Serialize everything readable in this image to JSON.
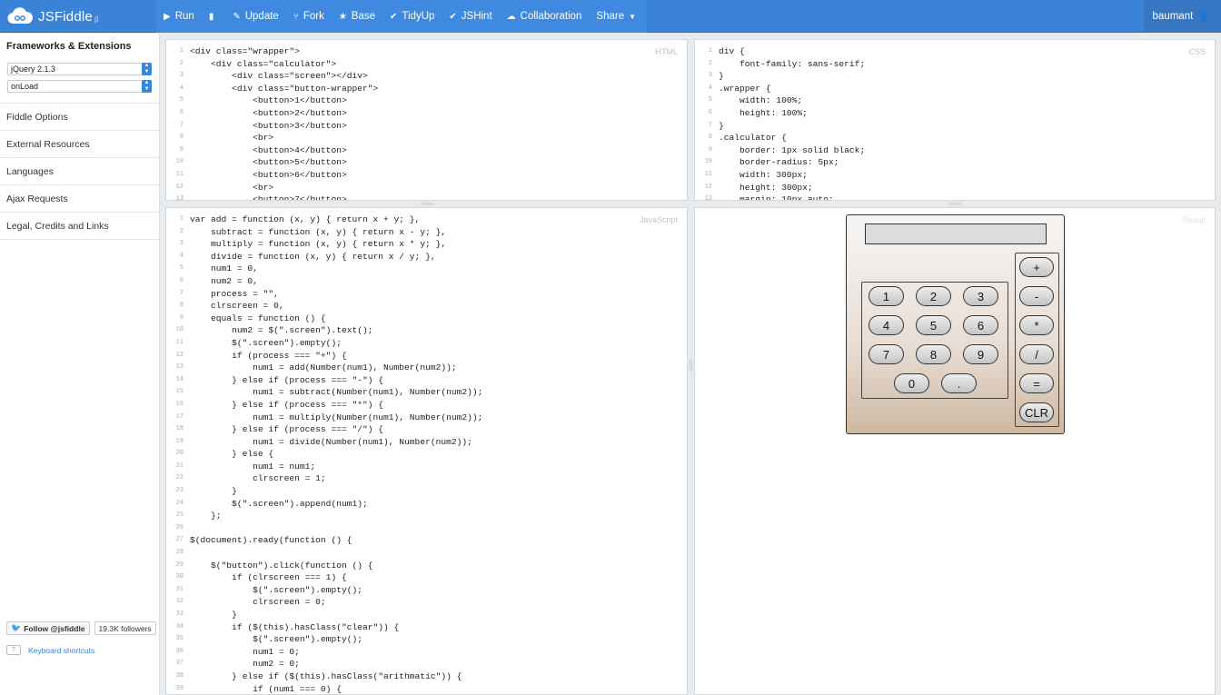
{
  "header": {
    "logo_text": "JSFiddle",
    "logo_beta": "β",
    "toolbar": [
      {
        "label": "Run",
        "icon": "play-icon",
        "glyph": "▶"
      },
      {
        "label": "",
        "icon": "bar-chart-icon",
        "glyph": "▮"
      },
      {
        "label": "Update",
        "icon": "pencil-icon",
        "glyph": "✎"
      },
      {
        "label": "Fork",
        "icon": "fork-icon",
        "glyph": "⑂"
      },
      {
        "label": "Base",
        "icon": "star-icon",
        "glyph": "★"
      },
      {
        "label": "TidyUp",
        "icon": "tidy-icon",
        "glyph": "✔"
      },
      {
        "label": "JSHint",
        "icon": "check-icon",
        "glyph": "✔"
      },
      {
        "label": "Collaboration",
        "icon": "cloud-icon",
        "glyph": "☁"
      },
      {
        "label": "Share",
        "icon": "caret-down-icon",
        "glyph": "▼"
      }
    ],
    "user": {
      "name": "baumant",
      "icon": "user-icon",
      "glyph": "👤"
    }
  },
  "sidebar": {
    "heading": "Frameworks & Extensions",
    "framework_select": "jQuery 2.1.3",
    "load_select": "onLoad",
    "items": [
      "Fiddle Options",
      "External Resources",
      "Languages",
      "Ajax Requests",
      "Legal, Credits and Links"
    ],
    "follow_label": "Follow @jsfiddle",
    "followers": "19.3K followers",
    "keyboard_shortcuts": "Keyboard shortcuts"
  },
  "html_panel": {
    "label": "HTML",
    "lines": [
      "<div class=\"wrapper\">",
      "    <div class=\"calculator\">",
      "        <div class=\"screen\"></div>",
      "        <div class=\"button-wrapper\">",
      "            <button>1</button>",
      "            <button>2</button>",
      "            <button>3</button>",
      "            <br>",
      "            <button>4</button>",
      "            <button>5</button>",
      "            <button>6</button>",
      "            <br>",
      "            <button>7</button>"
    ]
  },
  "css_panel": {
    "label": "CSS",
    "lines": [
      "div {",
      "    font-family: sans-serif;",
      "}",
      ".wrapper {",
      "    width: 100%;",
      "    height: 100%;",
      "}",
      ".calculator {",
      "    border: 1px solid black;",
      "    border-radius: 5px;",
      "    width: 300px;",
      "    height: 300px;",
      "    margin: 10px auto;"
    ]
  },
  "js_panel": {
    "label": "JavaScript",
    "lines": [
      "var add = function (x, y) { return x + y; },",
      "    subtract = function (x, y) { return x - y; },",
      "    multiply = function (x, y) { return x * y; },",
      "    divide = function (x, y) { return x / y; },",
      "    num1 = 0,",
      "    num2 = 0,",
      "    process = \"\",",
      "    clrscreen = 0,",
      "    equals = function () {",
      "        num2 = $(\".screen\").text();",
      "        $(\".screen\").empty();",
      "        if (process === \"+\") {",
      "            num1 = add(Number(num1), Number(num2));",
      "        } else if (process === \"-\") {",
      "            num1 = subtract(Number(num1), Number(num2));",
      "        } else if (process === \"*\") {",
      "            num1 = multiply(Number(num1), Number(num2));",
      "        } else if (process === \"/\") {",
      "            num1 = divide(Number(num1), Number(num2));",
      "        } else {",
      "            num1 = num1;",
      "            clrscreen = 1;",
      "        }",
      "        $(\".screen\").append(num1);",
      "    };",
      "",
      "$(document).ready(function () {",
      "",
      "    $(\"button\").click(function () {",
      "        if (clrscreen === 1) {",
      "            $(\".screen\").empty();",
      "            clrscreen = 0;",
      "        }",
      "        if ($(this).hasClass(\"clear\")) {",
      "            $(\".screen\").empty();",
      "            num1 = 0;",
      "            num2 = 0;",
      "        } else if ($(this).hasClass(\"arithmatic\")) {",
      "            if (num1 === 0) {"
    ]
  },
  "result_panel": {
    "label": "Result",
    "numpad_keys": [
      "1",
      "2",
      "3",
      "4",
      "5",
      "6",
      "7",
      "8",
      "9",
      "0",
      "."
    ],
    "operator_keys": [
      "+",
      "-",
      "*",
      "/",
      "=",
      "CLR"
    ]
  }
}
